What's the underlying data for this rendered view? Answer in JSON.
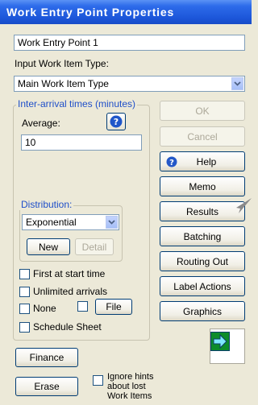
{
  "window": {
    "title": "Work Entry Point Properties"
  },
  "name_field": {
    "value": "Work Entry Point 1"
  },
  "input_type": {
    "label": "Input Work Item Type:",
    "selected": "Main Work Item Type"
  },
  "interarrival": {
    "legend": "Inter-arrival times (minutes)",
    "average_label": "Average:",
    "average_value": "10",
    "distribution_legend": "Distribution:",
    "distribution_selected": "Exponential",
    "new_label": "New",
    "detail_label": "Detail"
  },
  "checkboxes": {
    "first_at_start": "First at start time",
    "unlimited_arrivals": "Unlimited arrivals",
    "none": "None",
    "file_label": "File",
    "schedule_sheet": "Schedule Sheet"
  },
  "right_buttons": {
    "ok": "OK",
    "cancel": "Cancel",
    "help": "Help",
    "memo": "Memo",
    "results": "Results",
    "batching": "Batching",
    "routing_out": "Routing Out",
    "label_actions": "Label Actions",
    "graphics": "Graphics"
  },
  "bottom": {
    "finance": "Finance",
    "erase": "Erase",
    "ignore_hints_line1": "Ignore hints",
    "ignore_hints_line2": "about lost",
    "ignore_hints_line3": "Work Items"
  },
  "colors": {
    "title_bar": "#1c56d9",
    "legend_text": "#1f4fc9",
    "window_bg": "#ece9d8",
    "entry_icon": "#0d8c2b"
  },
  "icons": {
    "help_button": "question-circle-icon",
    "average_help": "help-icon",
    "dropdown": "chevron-down-icon",
    "entry_graphic": "green-arrow-right-icon",
    "pointer": "arrow-pointer-icon"
  }
}
